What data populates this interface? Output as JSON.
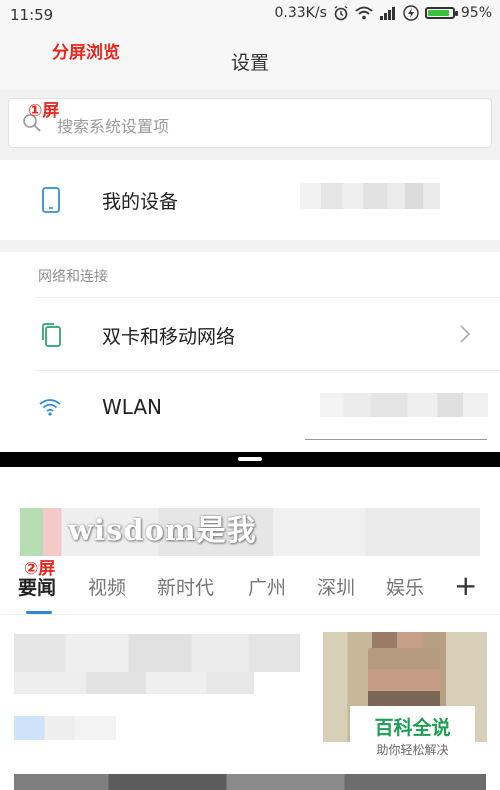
{
  "status_bar": {
    "time": "11:59",
    "network_speed": "0.33K/s",
    "battery_percent": "95%",
    "battery_level": 0.95,
    "icons": [
      "alarm-icon",
      "wifi-icon",
      "signal-icon",
      "charging-icon",
      "battery-icon"
    ]
  },
  "annotations": {
    "split_view": "分屏浏览",
    "screen_1": "①屏",
    "screen_2": "②屏"
  },
  "settings": {
    "title": "设置",
    "search": {
      "placeholder": "搜索系统设置项"
    },
    "my_device": {
      "label": "我的设备"
    },
    "section_title": "网络和连接",
    "items": [
      {
        "label": "双卡和移动网络",
        "icon": "dual-sim-icon"
      },
      {
        "label": "WLAN",
        "icon": "wifi-icon"
      }
    ]
  },
  "news": {
    "watermark": "wisdom是我",
    "tabs": [
      {
        "label": "要闻",
        "active": true
      },
      {
        "label": "视频",
        "active": false
      },
      {
        "label": "新时代",
        "active": false
      },
      {
        "label": "广州",
        "active": false
      },
      {
        "label": "深圳",
        "active": false
      },
      {
        "label": "娱乐",
        "active": false
      }
    ],
    "add_tab": "+"
  },
  "badge": {
    "title": "百科全说",
    "subtitle": "助你轻松解决"
  },
  "colors": {
    "annotation_red": "#e8271f",
    "tab_accent": "#2d88d6",
    "badge_green": "#1f9d55",
    "battery_green": "#35c43b"
  }
}
